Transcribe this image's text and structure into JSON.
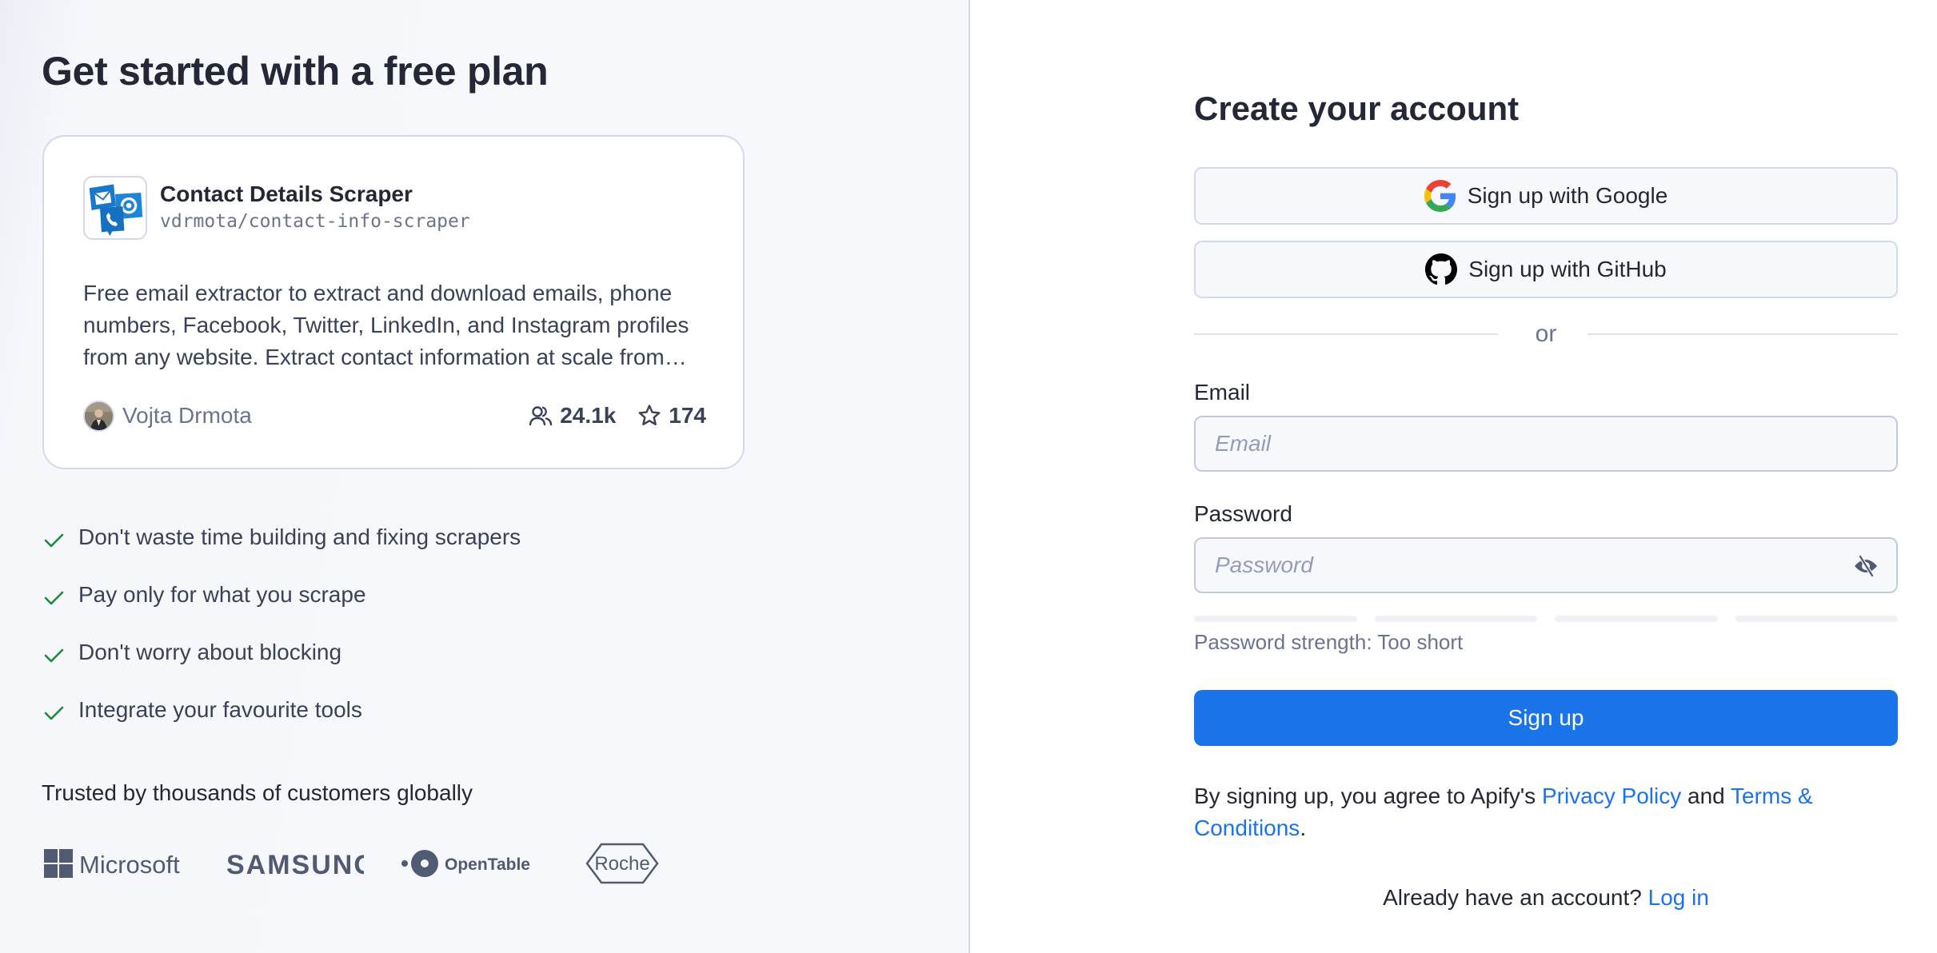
{
  "left": {
    "title": "Get started with a free plan",
    "actor": {
      "title": "Contact Details Scraper",
      "slug": "vdrmota/contact-info-scraper",
      "description": "Free email extractor to extract and download emails, phone numbers, Facebook, Twitter, LinkedIn, and Instagram profiles from any website. Extract contact information at scale from…",
      "author": "Vojta Drmota",
      "users_count": "24.1k",
      "stars_count": "174",
      "icon": "contact-scraper-icon",
      "users_icon": "users-icon",
      "star_icon": "star-icon"
    },
    "features": [
      {
        "text": "Don't waste time building and fixing scrapers",
        "icon": "check-icon"
      },
      {
        "text": "Pay only for what you scrape",
        "icon": "check-icon"
      },
      {
        "text": "Don't worry about blocking",
        "icon": "check-icon"
      },
      {
        "text": "Integrate your favourite tools",
        "icon": "check-icon"
      }
    ],
    "trusted_text": "Trusted by thousands of customers globally",
    "logos": [
      {
        "name": "Microsoft"
      },
      {
        "name": "SAMSUNG"
      },
      {
        "name": "OpenTable"
      },
      {
        "name": "Roche"
      }
    ]
  },
  "form": {
    "title": "Create your account",
    "google_label": "Sign up with Google",
    "github_label": "Sign up with GitHub",
    "divider_text": "or",
    "email_label": "Email",
    "email_placeholder": "Email",
    "email_value": "",
    "password_label": "Password",
    "password_placeholder": "Password",
    "password_value": "",
    "password_toggle_icon": "eye-off-icon",
    "strength_segments_total": 4,
    "strength_segments_filled": 0,
    "strength_text": "Password strength: Too short",
    "submit_label": "Sign up",
    "terms": {
      "prefix": "By signing up, you agree to Apify's ",
      "privacy_link": "Privacy Policy",
      "middle": " and ",
      "terms_link": "Terms & Conditions",
      "suffix": "."
    },
    "login": {
      "prompt": "Already have an account? ",
      "link": "Log in"
    }
  },
  "colors": {
    "accent": "#1a73e8",
    "check": "#1e8a3c",
    "left_bg": "#f7f8fb",
    "border": "#d3d9ec",
    "muted_text": "#6b7390"
  }
}
